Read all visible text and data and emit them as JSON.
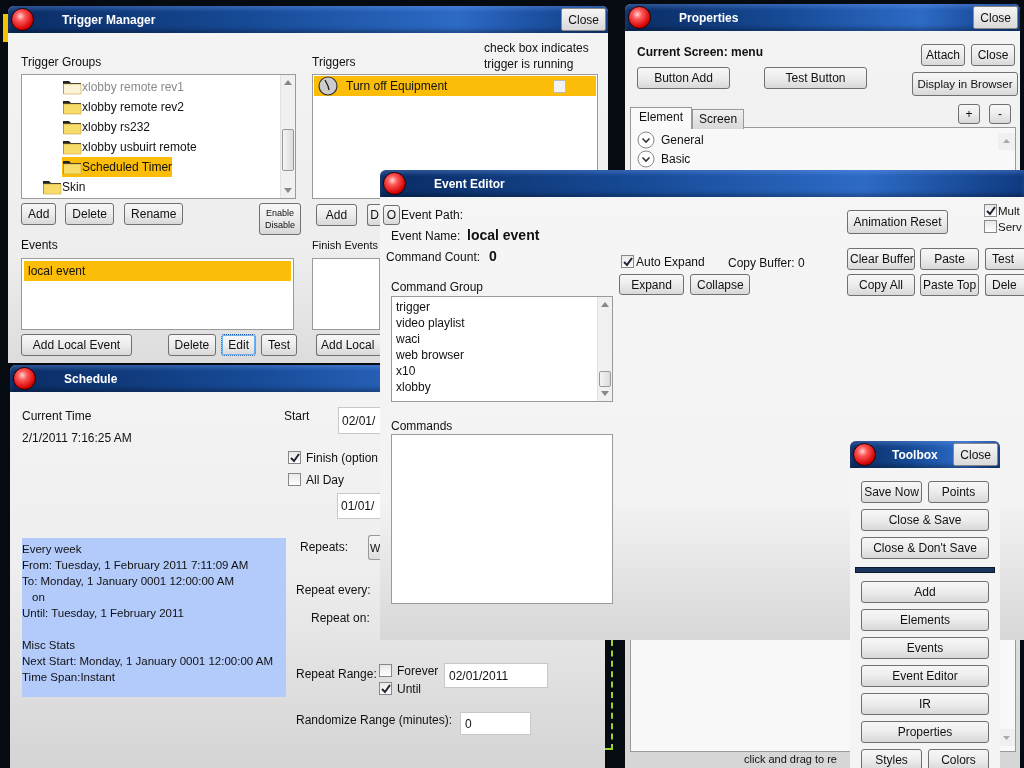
{
  "trigger_manager": {
    "title": "Trigger Manager",
    "close": "Close",
    "groups_label": "Trigger Groups",
    "groups": [
      {
        "children": [
          {
            "label": "xlobby remote rev1",
            "disabled": true,
            "selected": false
          },
          {
            "label": "xlobby remote rev2",
            "disabled": false,
            "selected": false
          },
          {
            "label": "xlobby rs232",
            "disabled": false,
            "selected": false
          },
          {
            "label": "xlobby usbuirt remote",
            "disabled": false,
            "selected": false
          },
          {
            "label": "Scheduled Timer",
            "disabled": false,
            "selected": true
          }
        ]
      },
      {
        "label": "Skin",
        "disabled": false,
        "selected": false
      }
    ],
    "group_buttons": [
      "Add",
      "Delete",
      "Rename",
      "Enable Disable"
    ],
    "triggers_label": "Triggers",
    "triggers_hint": "check box indicates trigger is running",
    "triggers": [
      {
        "label": "Turn off Equipment",
        "selected": true,
        "running": false
      }
    ],
    "trigger_buttons": [
      "Add",
      "D"
    ],
    "events_label": "Events",
    "events": [
      {
        "label": "local event",
        "selected": true
      }
    ],
    "event_buttons": [
      {
        "label": "Add Local Event",
        "focused": false
      },
      {
        "label": "Delete",
        "focused": false
      },
      {
        "label": "Edit",
        "focused": true
      },
      {
        "label": "Test",
        "focused": false
      }
    ],
    "finish_label": "Finish Events",
    "finish_button": "Add Local"
  },
  "properties": {
    "title": "Properties",
    "close": "Close",
    "current_screen": "Current Screen: menu",
    "buttons_left": [
      "Button Add",
      "Test Button"
    ],
    "buttons_right": [
      "Attach",
      "Close"
    ],
    "display_button": "Display in Browser",
    "zoom_buttons": [
      "+",
      "-"
    ],
    "tabs": [
      {
        "label": "Element",
        "selected": true
      },
      {
        "label": "Screen",
        "selected": false
      }
    ],
    "sections": [
      {
        "label": "General",
        "expanded": false
      },
      {
        "label": "Basic",
        "expanded": false
      }
    ],
    "status": "click and drag to re"
  },
  "schedule": {
    "title": "Schedule",
    "current_time_label": "Current Time",
    "current_time": "2/1/2011 7:16:25 AM",
    "start_label": "Start",
    "start_value": "02/01/",
    "finish": {
      "label": "Finish (option",
      "checked": true
    },
    "all_day": {
      "label": "All Day",
      "checked": false
    },
    "finish_value": "01/01/",
    "summary": [
      {
        "lines": [
          "Every week",
          "From: Tuesday, 1 February 2011 7:11:09 AM",
          "To: Monday, 1 January 0001 12:00:00 AM",
          "on",
          "Until: Tuesday, 1 February 2011"
        ]
      },
      {
        "lines": [
          "Misc Stats",
          "Next Start: Monday, 1 January 0001 12:00:00 AM",
          "Time Span:Instant"
        ]
      }
    ],
    "repeats_label": "Repeats:",
    "repeats_value": "W",
    "repeat_every_label": "Repeat every:",
    "repeat_on_label": "Repeat on:",
    "repeat_range_label": "Repeat Range:",
    "forever": {
      "label": "Forever",
      "checked": false
    },
    "until": {
      "label": "Until",
      "checked": true
    },
    "until_value": "02/01/2011",
    "randomize_label": "Randomize Range (minutes):",
    "randomize_value": "0"
  },
  "event_editor": {
    "title": "Event Editor",
    "path_button": "O",
    "path_label": "Event Path:",
    "name_label": "Event Name:",
    "name": "local event",
    "count_label": "Command Count:",
    "count": "0",
    "auto_expand": {
      "label": "Auto Expand",
      "checked": true
    },
    "copy_buffer_label": "Copy Buffer:",
    "copy_buffer": "0",
    "expand_buttons": [
      "Expand",
      "Collapse"
    ],
    "group_label": "Command Group",
    "groups": [
      "trigger",
      "video playlist",
      "waci",
      "web browser",
      "x10",
      "xlobby"
    ],
    "commands_label": "Commands",
    "animation_reset": "Animation Reset",
    "options": [
      {
        "label": "Mult",
        "checked": true
      },
      {
        "label": "Serv",
        "checked": false
      }
    ],
    "buffer_buttons": [
      [
        "Clear Buffer",
        "Paste",
        "Test"
      ],
      [
        "Copy All",
        "Paste Top",
        "Dele"
      ]
    ]
  },
  "toolbox": {
    "title": "Toolbox",
    "close": "Close",
    "rows": [
      {
        "kind": "buttons",
        "buttons": [
          "Save Now",
          "Points"
        ]
      },
      {
        "kind": "buttons",
        "buttons": [
          "Close & Save"
        ]
      },
      {
        "kind": "buttons",
        "buttons": [
          "Close & Don't Save"
        ]
      },
      {
        "kind": "separator"
      },
      {
        "kind": "buttons",
        "buttons": [
          "Add"
        ]
      },
      {
        "kind": "buttons",
        "buttons": [
          "Elements"
        ]
      },
      {
        "kind": "buttons",
        "buttons": [
          "Events"
        ]
      },
      {
        "kind": "buttons",
        "buttons": [
          "Event Editor"
        ]
      },
      {
        "kind": "buttons",
        "buttons": [
          "IR"
        ]
      },
      {
        "kind": "buttons",
        "buttons": [
          "Properties"
        ]
      },
      {
        "kind": "buttons",
        "buttons": [
          "Styles",
          "Colors"
        ]
      }
    ]
  }
}
